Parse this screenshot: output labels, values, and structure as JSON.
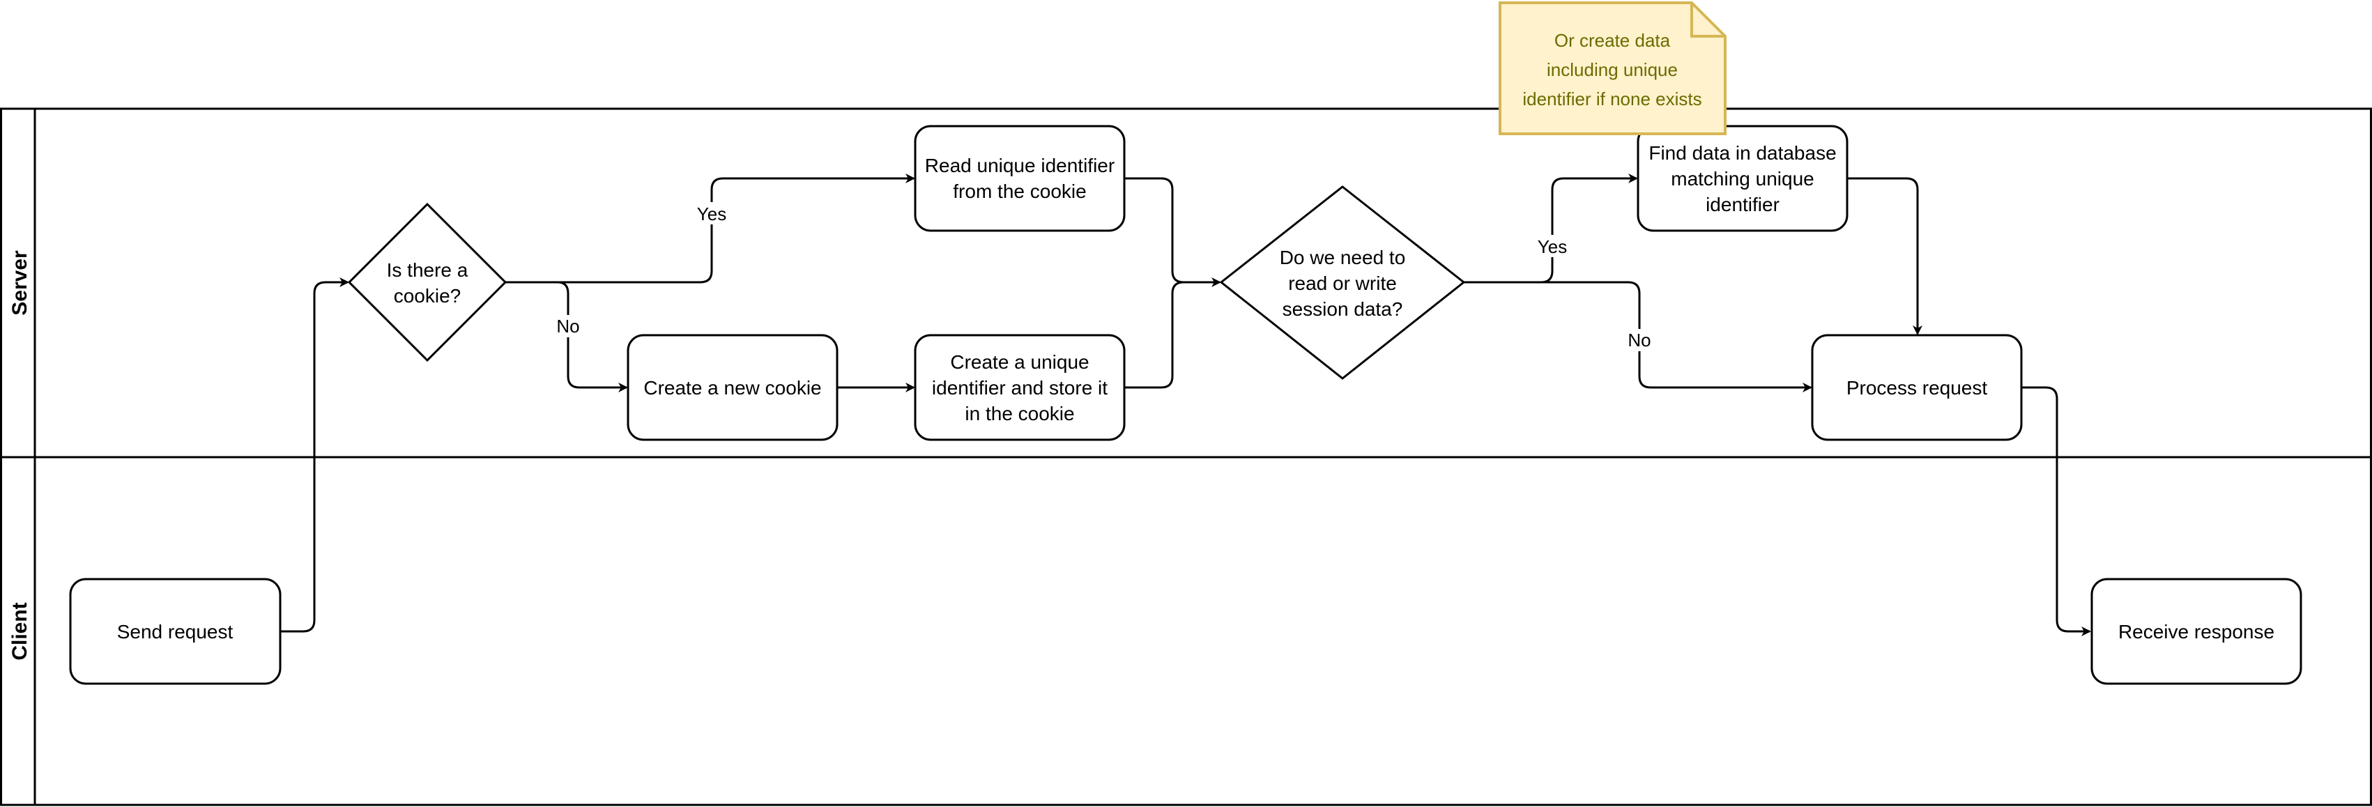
{
  "diagram": {
    "type": "swimlane-flowchart",
    "lanes": [
      {
        "id": "server",
        "label": "Server"
      },
      {
        "id": "client",
        "label": "Client"
      }
    ],
    "nodes": [
      {
        "id": "send",
        "lane": "client",
        "shape": "rounded-rect",
        "lines": [
          "Send request"
        ]
      },
      {
        "id": "cookie_q",
        "lane": "server",
        "shape": "diamond",
        "lines": [
          "Is there a",
          "cookie?"
        ]
      },
      {
        "id": "read_id",
        "lane": "server",
        "shape": "rounded-rect",
        "lines": [
          "Read unique identifier",
          "from the cookie"
        ]
      },
      {
        "id": "new_cookie",
        "lane": "server",
        "shape": "rounded-rect",
        "lines": [
          "Create a new cookie"
        ]
      },
      {
        "id": "create_id",
        "lane": "server",
        "shape": "rounded-rect",
        "lines": [
          "Create a unique",
          "identifier and store it",
          "in the cookie"
        ]
      },
      {
        "id": "session_q",
        "lane": "server",
        "shape": "diamond",
        "lines": [
          "Do we need to",
          "read or write",
          "session data?"
        ]
      },
      {
        "id": "find_data",
        "lane": "server",
        "shape": "rounded-rect",
        "lines": [
          "Find data in database",
          "matching unique",
          "identifier"
        ]
      },
      {
        "id": "process",
        "lane": "server",
        "shape": "rounded-rect",
        "lines": [
          "Process request"
        ]
      },
      {
        "id": "receive",
        "lane": "client",
        "shape": "rounded-rect",
        "lines": [
          "Receive response"
        ]
      }
    ],
    "edges": [
      {
        "from": "send",
        "to": "cookie_q",
        "label": ""
      },
      {
        "from": "cookie_q",
        "to": "read_id",
        "label": "Yes"
      },
      {
        "from": "cookie_q",
        "to": "new_cookie",
        "label": "No"
      },
      {
        "from": "new_cookie",
        "to": "create_id",
        "label": ""
      },
      {
        "from": "read_id",
        "to": "session_q",
        "label": ""
      },
      {
        "from": "create_id",
        "to": "session_q",
        "label": ""
      },
      {
        "from": "session_q",
        "to": "find_data",
        "label": "Yes"
      },
      {
        "from": "session_q",
        "to": "process",
        "label": "No"
      },
      {
        "from": "find_data",
        "to": "process",
        "label": ""
      },
      {
        "from": "process",
        "to": "receive",
        "label": ""
      }
    ],
    "note": {
      "lines": [
        "Or create data",
        "including unique",
        "identifier if none exists"
      ],
      "fill": "#fff2cc",
      "stroke": "#d6b656",
      "text_color": "#6b6b00"
    },
    "colors": {
      "stroke": "#000000",
      "background": "#ffffff"
    }
  }
}
